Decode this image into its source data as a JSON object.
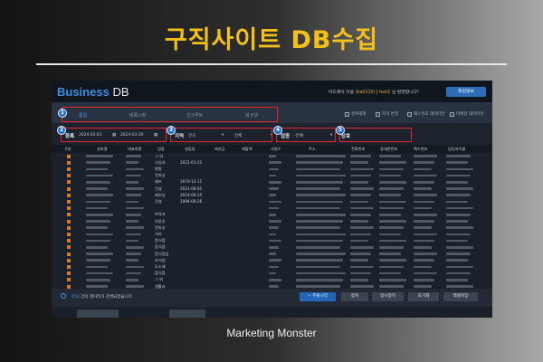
{
  "headline": "구직사이트 DB수집",
  "caption": "Marketing Monster",
  "header": {
    "brand_main": "Business",
    "brand_sub": "DB",
    "welcome_prefix": "아드레이 이용",
    "welcome_id": "(ba0210)",
    "welcome_sep": "|",
    "welcome_user": "test1",
    "welcome_suffix": "님 환영합니다!",
    "info_button": "회원정보"
  },
  "tabs": [
    {
      "label": "통합",
      "active": true
    },
    {
      "label": "벼룩시장",
      "active": false
    },
    {
      "label": "인크루트",
      "active": false
    },
    {
      "label": "워크넷",
      "active": false
    }
  ],
  "checks": [
    "중복제외",
    "지역 변경",
    "팩스번호 데이터만",
    "이메일 데이터만"
  ],
  "filters": {
    "period_label": "등록",
    "date_from": "2024-03-01",
    "date_to": "2024-03-20",
    "region_label": "지역",
    "region_value": "전국",
    "region_sub": "전체",
    "industry_label": "업종",
    "industry_value": "-전체-",
    "company_label": "상호"
  },
  "callouts": [
    "1",
    "2",
    "3",
    "4",
    "5"
  ],
  "columns": [
    "구분",
    "상호명",
    "대표자명",
    "업종",
    "설립일",
    "자본금",
    "매출액",
    "사원수",
    "주소",
    "전화번호",
    "휴대폰번호",
    "팩스번호",
    "담당자이름"
  ],
  "rows": [
    {
      "type": "그 외",
      "date": ""
    },
    {
      "type": "사업서",
      "date": "2021-01-21"
    },
    {
      "type": "병원",
      "date": ""
    },
    {
      "type": "전자상",
      "date": ""
    },
    {
      "type": "제조",
      "date": "1970-12-11"
    },
    {
      "type": "건설",
      "date": "2021-08-01"
    },
    {
      "type": "제조업",
      "date": "2014-09-25"
    },
    {
      "type": "건설",
      "date": "1994-09-26"
    },
    {
      "type": "",
      "date": ""
    },
    {
      "type": "보육서",
      "date": ""
    },
    {
      "type": "부동산",
      "date": ""
    },
    {
      "type": "전자상",
      "date": ""
    },
    {
      "type": "기타",
      "date": ""
    },
    {
      "type": "음식점",
      "date": ""
    },
    {
      "type": "음식점",
      "date": ""
    },
    {
      "type": "음식점업",
      "date": ""
    },
    {
      "type": "요식업",
      "date": ""
    },
    {
      "type": "도소매",
      "date": ""
    },
    {
      "type": "음식점",
      "date": ""
    },
    {
      "type": "그 외",
      "date": ""
    },
    {
      "type": "생활서",
      "date": ""
    }
  ],
  "footer": {
    "count_prefix": "450",
    "count_text": "건의 데이터가 검색되었습니다.",
    "buttons": [
      "+ 추출시작",
      "정지",
      "일시정지",
      "초기화",
      "엑셀저장"
    ]
  },
  "colors": {
    "accent": "#f2c019",
    "brand": "#3f8fe0",
    "callout": "#e4232c",
    "badge": "#1d6fd0"
  }
}
